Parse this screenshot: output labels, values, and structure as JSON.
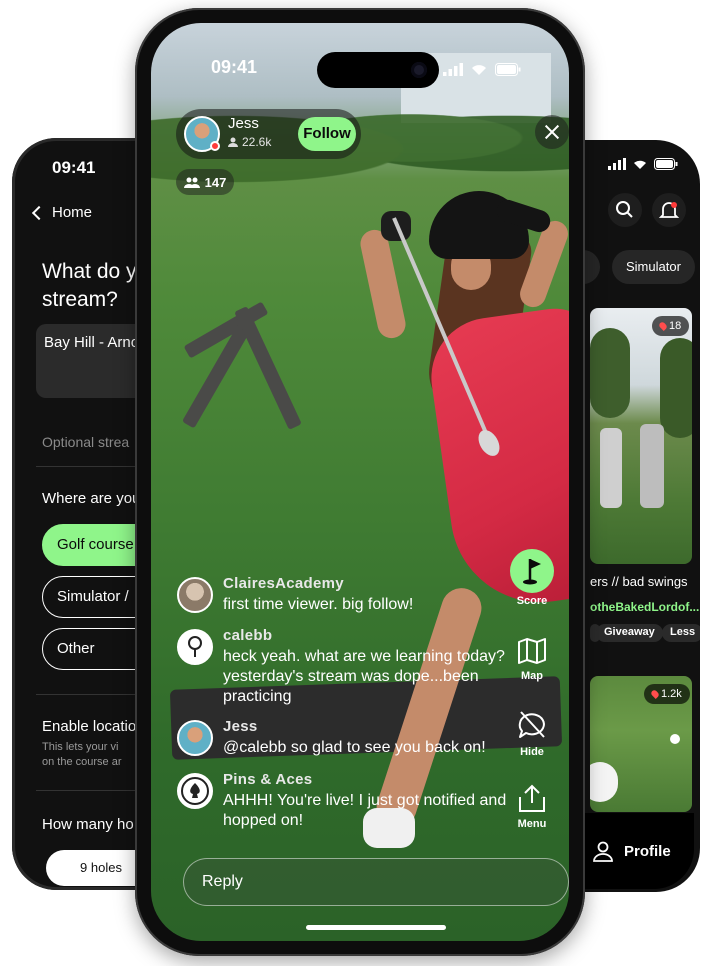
{
  "left_phone": {
    "time": "09:41",
    "back_label": "Home",
    "question_title": "What do y… stream?",
    "title_line1": "What do y",
    "title_line2": "stream?",
    "stream_name_value": "Bay Hill - Arno",
    "optional_label": "Optional strea",
    "where_question": "Where are you",
    "location_options": [
      "Golf course",
      "Simulator /",
      "Other"
    ],
    "selected_option": "Golf course",
    "enable_location_label": "Enable locatio",
    "enable_location_desc_line1": "This lets your vi",
    "enable_location_desc_line2": "on the course ar",
    "holes_question": "How many ho",
    "holes_value": "9 holes"
  },
  "center_phone": {
    "time": "09:41",
    "host": {
      "name": "Jess",
      "followers": "22.6k",
      "follow_label": "Follow"
    },
    "viewer_count": "147",
    "chat": [
      {
        "user": "ClairesAcademy",
        "message": "first time viewer. big follow!"
      },
      {
        "user": "calebb",
        "message": "heck yeah. what are we learning today? yesterday's stream was dope...been practicing"
      },
      {
        "user": "Jess",
        "message": "@calebb so glad to see you back on!"
      },
      {
        "user": "Pins & Aces",
        "message": "AHHH! You're live! I just got notified and hopped on!"
      }
    ],
    "actions": {
      "score": "Score",
      "map": "Map",
      "hide": "Hide",
      "menu": "Menu"
    },
    "reply_placeholder": "Reply"
  },
  "right_phone": {
    "chip_partial": "s",
    "chip_simulator": "Simulator",
    "card1_badge": "18",
    "card2_badge": "1.2k",
    "card_caption": "ers // bad swings",
    "card_user": "otheBakedLordof...",
    "tags": [
      "Giveaway",
      "Less"
    ],
    "profile_label": "Profile"
  },
  "colors": {
    "accent_green": "#8ff58a",
    "live_red": "#ff3b3b",
    "dress_red": "#e63b52",
    "phone_black": "#111111"
  }
}
